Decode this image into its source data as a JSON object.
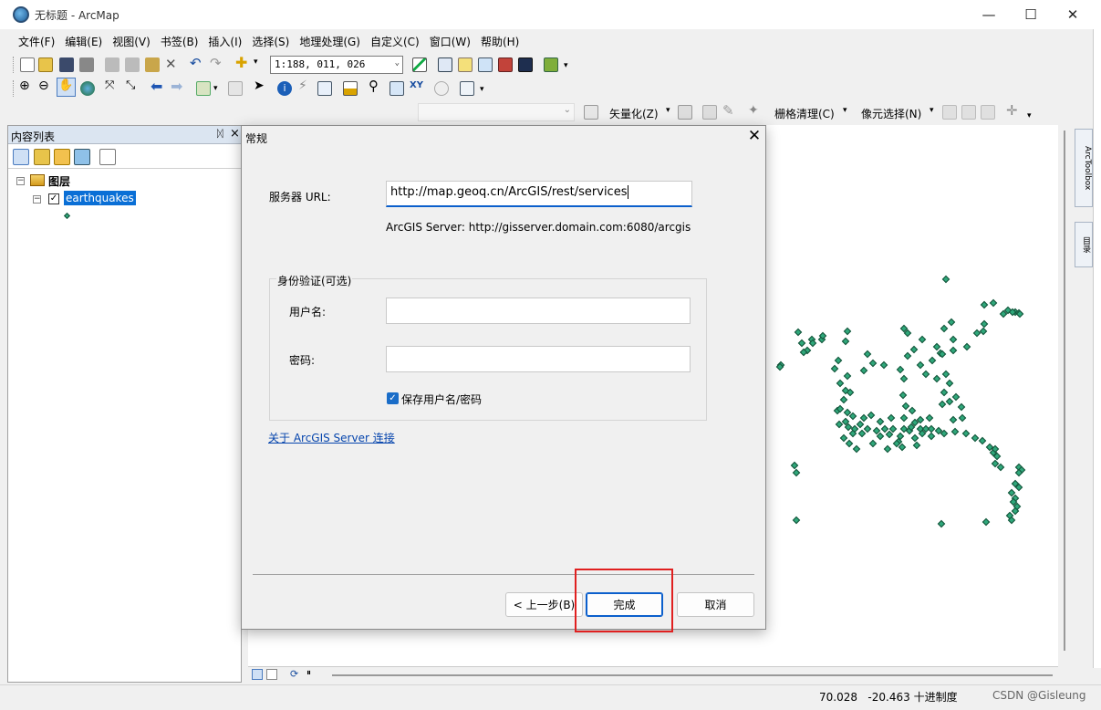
{
  "window": {
    "title": "无标题 - ArcMap",
    "controls": [
      "—",
      "☐",
      "✕"
    ]
  },
  "menu": [
    "文件(F)",
    "编辑(E)",
    "视图(V)",
    "书签(B)",
    "插入(I)",
    "选择(S)",
    "地理处理(G)",
    "自定义(C)",
    "窗口(W)",
    "帮助(H)"
  ],
  "toolbar": {
    "scale": "1:188, 011, 026",
    "vectorize": "矢量化(Z)",
    "raster_cleanup": "栅格清理(C)",
    "pixel_select": "像元选择(N)"
  },
  "toc": {
    "title": "内容列表",
    "pin": "ᛞ",
    "close": "×",
    "root_label": "图层",
    "layer_name": "earthquakes"
  },
  "right_tabs": [
    "ArcToolbox",
    "目录"
  ],
  "status": {
    "coords": "70.028   -20.463 十进制度",
    "watermark": "CSDN @Gisleung"
  },
  "dialog": {
    "title": "常规",
    "close": "✕",
    "server_url_label": "服务器 URL:",
    "server_url_value": "http://map.geoq.cn/ArcGIS/rest/services",
    "server_url_hint": "ArcGIS Server: http://gisserver.domain.com:6080/arcgis",
    "auth_group": "身份验证(可选)",
    "username_label": "用户名:",
    "username_value": "",
    "password_label": "密码:",
    "password_value": "",
    "save_checkbox_label": "保存用户名/密码",
    "save_checked": true,
    "about_link": "关于 ArcGIS Server 连接",
    "back_button": "< 上一步(B)",
    "finish_button": "完成",
    "cancel_button": "取消"
  },
  "colors": {
    "point_fill": "#2fa77a",
    "highlight": "#e02020",
    "toc_header": "#dbe5f1",
    "selection": "#0a6fd6"
  }
}
